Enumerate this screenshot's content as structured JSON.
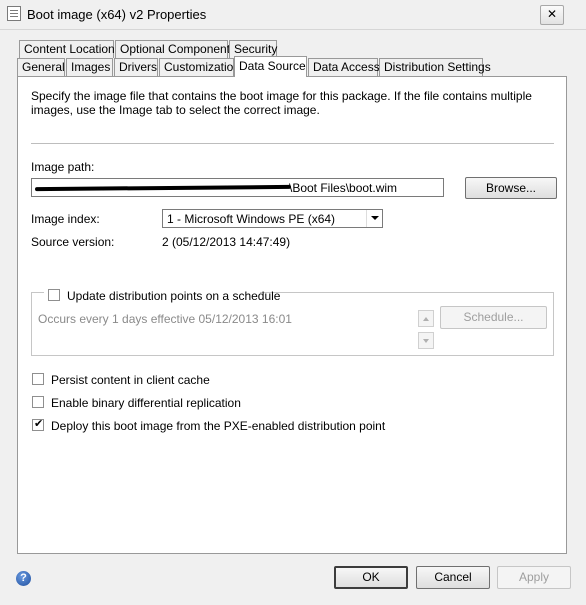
{
  "window": {
    "title": "Boot image (x64) v2 Properties",
    "close_glyph": "✕"
  },
  "tabs_row1": [
    {
      "label": "Content Locations"
    },
    {
      "label": "Optional Components"
    },
    {
      "label": "Security"
    }
  ],
  "tabs_row2": [
    {
      "label": "General"
    },
    {
      "label": "Images"
    },
    {
      "label": "Drivers"
    },
    {
      "label": "Customization"
    },
    {
      "label": "Data Source",
      "active": true
    },
    {
      "label": "Data Access"
    },
    {
      "label": "Distribution Settings"
    }
  ],
  "content": {
    "description": "Specify the image file that contains the boot image for this package. If the file contains multiple images, use the Image tab to select the correct image.",
    "image_path_label": "Image path:",
    "image_path_value": "\\Boot Files\\boot.wim",
    "browse_button": "Browse...",
    "image_index_label": "Image index:",
    "image_index_value": "1 - Microsoft Windows PE (x64)",
    "source_version_label": "Source version:",
    "source_version_value": "2 (05/12/2013 14:47:49)",
    "schedule_checkbox_label": "Update distribution points on a schedule",
    "schedule_checked": false,
    "schedule_text": "Occurs every 1 days effective 05/12/2013 16:01",
    "schedule_button": "Schedule...",
    "persist_label": "Persist content in client cache",
    "persist_checked": false,
    "binary_label": "Enable binary differential replication",
    "binary_checked": false,
    "pxe_label": "Deploy this boot image from the PXE-enabled distribution point",
    "pxe_checked": true
  },
  "footer": {
    "help_glyph": "?",
    "ok": "OK",
    "cancel": "Cancel",
    "apply": "Apply"
  },
  "glyphs": {
    "check": "✔"
  }
}
